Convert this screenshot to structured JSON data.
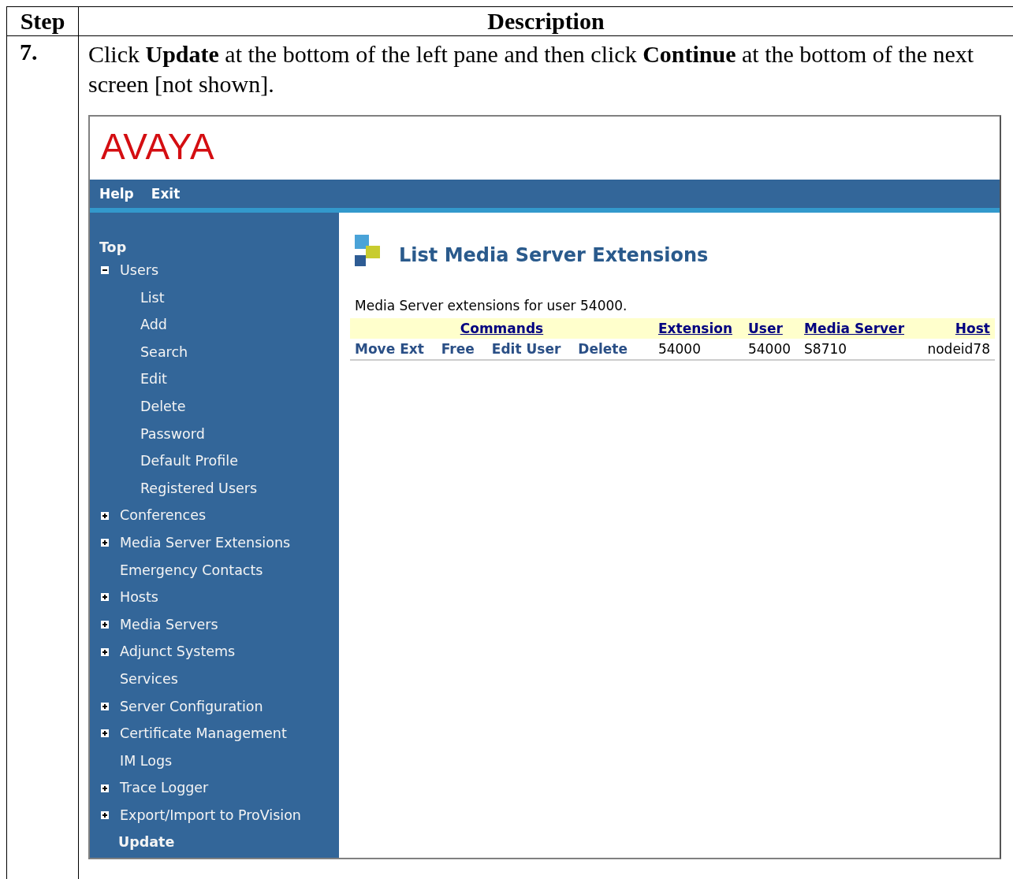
{
  "table": {
    "columns": [
      "Step",
      "Description"
    ],
    "step": "7.",
    "instruction": "Click **Update** at the bottom of the left pane and then click **Continue** at the bottom of the next screen [not shown].",
    "screenshot": {
      "logo": "AVAYA",
      "nav": [
        "Help",
        "Exit"
      ],
      "sidebar": [
        {
          "label": "Top",
          "kind": "heading"
        },
        {
          "label": "Users",
          "kind": "item",
          "expanded": true,
          "children": [
            {
              "label": "List"
            },
            {
              "label": "Add"
            },
            {
              "label": "Search"
            },
            {
              "label": "Edit"
            },
            {
              "label": "Delete"
            },
            {
              "label": "Password"
            },
            {
              "label": "Default Profile"
            },
            {
              "label": "Registered Users"
            }
          ]
        },
        {
          "label": "Conferences",
          "kind": "item",
          "expanded": false
        },
        {
          "label": "Media Server Extensions",
          "kind": "item",
          "expanded": false
        },
        {
          "label": "Emergency Contacts",
          "kind": "item"
        },
        {
          "label": "Hosts",
          "kind": "item",
          "expanded": false
        },
        {
          "label": "Media Servers",
          "kind": "item",
          "expanded": false
        },
        {
          "label": "Adjunct Systems",
          "kind": "item",
          "expanded": false
        },
        {
          "label": "Services",
          "kind": "item"
        },
        {
          "label": "Server Configuration",
          "kind": "item",
          "expanded": false
        },
        {
          "label": "Certificate Management",
          "kind": "item",
          "expanded": false
        },
        {
          "label": "IM Logs",
          "kind": "item"
        },
        {
          "label": "Trace Logger",
          "kind": "item",
          "expanded": false
        },
        {
          "label": "Export/Import to ProVision",
          "kind": "item",
          "expanded": false
        },
        {
          "label": "Update",
          "kind": "heading"
        }
      ],
      "page_title": "List Media Server Extensions",
      "subtitle": "Media Server extensions for user 54000.",
      "grid": {
        "columns": [
          "Commands",
          "Extension",
          "User",
          "Media Server",
          "Host"
        ],
        "rows": [
          {
            "cells": [
              {
                "kind": "commands",
                "links": [
                  "Move Ext",
                  "Free",
                  "Edit User",
                  "Delete"
                ]
              },
              {
                "kind": "text",
                "text": "54000"
              },
              {
                "kind": "text",
                "text": "54000"
              },
              {
                "kind": "text",
                "text": "S8710"
              },
              {
                "kind": "text",
                "text": "nodeid78"
              }
            ]
          }
        ]
      }
    }
  }
}
